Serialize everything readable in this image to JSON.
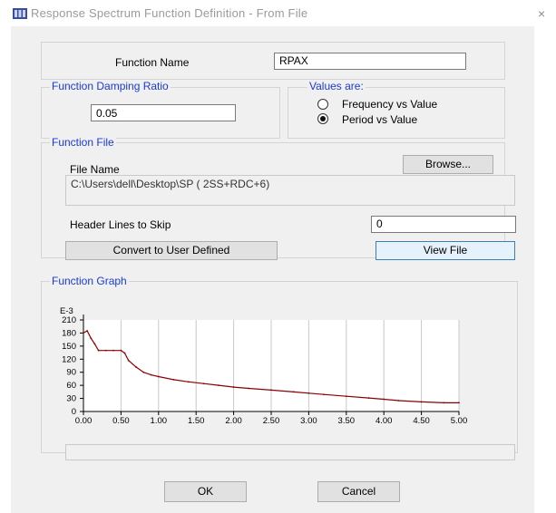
{
  "window": {
    "title": "Response Spectrum Function Definition - From File",
    "close_glyph": "×"
  },
  "function_name": {
    "label": "Function Name",
    "value": "RPAX"
  },
  "damping": {
    "legend": "Function Damping Ratio",
    "value": "0.05"
  },
  "values_are": {
    "legend": "Values are:",
    "options": [
      {
        "label": "Frequency vs Value",
        "selected": false
      },
      {
        "label": "Period vs Value",
        "selected": true
      }
    ]
  },
  "function_file": {
    "legend": "Function File",
    "file_name_label": "File Name",
    "browse_label": "Browse...",
    "path": "C:\\Users\\dell\\Desktop\\SP ( 2SS+RDC+6)",
    "header_lines_label": "Header Lines to Skip",
    "header_lines_value": "0",
    "convert_label": "Convert to User Defined",
    "view_file_label": "View File"
  },
  "graph": {
    "legend": "Function Graph"
  },
  "chart_data": {
    "type": "line",
    "y_scale_label": "E-3",
    "x_ticks": [
      "0.00",
      "0.50",
      "1.00",
      "1.50",
      "2.00",
      "2.50",
      "3.00",
      "3.50",
      "4.00",
      "4.50",
      "5.00"
    ],
    "y_ticks": [
      "0",
      "30",
      "60",
      "90",
      "120",
      "150",
      "180",
      "210"
    ],
    "xlim": [
      0,
      5
    ],
    "ylim": [
      0,
      210
    ],
    "grid": "vertical",
    "series": [
      {
        "color": "#8b0000",
        "x": [
          0.0,
          0.05,
          0.1,
          0.15,
          0.2,
          0.3,
          0.4,
          0.5,
          0.55,
          0.6,
          0.7,
          0.8,
          0.9,
          1.0,
          1.2,
          1.4,
          1.6,
          1.8,
          2.0,
          2.2,
          2.5,
          2.8,
          3.0,
          3.2,
          3.5,
          3.8,
          4.0,
          4.2,
          4.5,
          4.8,
          5.0
        ],
        "y": [
          180,
          185,
          168,
          155,
          140,
          140,
          140,
          140,
          134,
          117,
          102,
          90,
          84,
          80,
          73,
          68,
          64,
          60,
          56,
          53,
          49,
          45,
          42,
          39,
          35,
          31,
          28,
          25,
          22,
          20,
          20
        ]
      }
    ]
  },
  "status_bar_value": "",
  "ok_label": "OK",
  "cancel_label": "Cancel"
}
